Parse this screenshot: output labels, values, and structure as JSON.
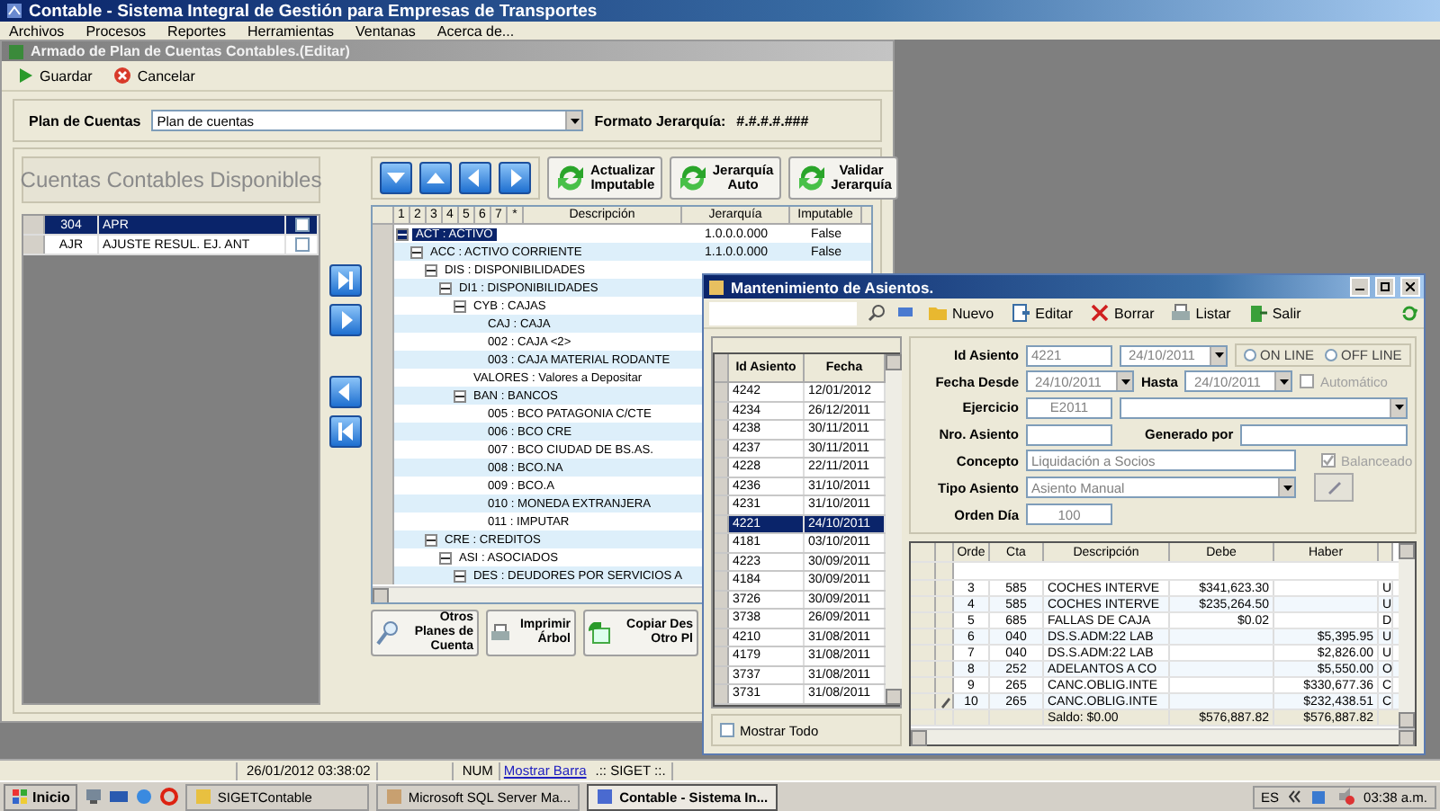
{
  "app": {
    "title": "Contable - Sistema Integral de Gestión para Empresas de Transportes",
    "menu": [
      "Archivos",
      "Procesos",
      "Reportes",
      "Herramientas",
      "Ventanas",
      "Acerca de..."
    ]
  },
  "editor": {
    "title": "Armado de Plan de Cuentas Contables.(Editar)",
    "toolbar": [
      {
        "kind": "save",
        "label": "Guardar"
      },
      {
        "kind": "cancel",
        "label": "Cancelar"
      }
    ],
    "plan_label": "Plan de Cuentas",
    "plan_value": "Plan de cuentas",
    "format_label": "Formato Jerarquía:",
    "format_value": "#.#.#.#.###",
    "available_title": "Cuentas Contables Disponibles",
    "available": [
      {
        "code": "304",
        "name": "APR",
        "checked": false,
        "selected": true
      },
      {
        "code": "AJR",
        "name": "AJUSTE RESUL. EJ. ANT",
        "checked": false,
        "selected": false
      }
    ],
    "actions": [
      "Actualizar Imputable",
      "Jerarquía Auto",
      "Validar Jerarquía"
    ],
    "tree_levels": [
      "1",
      "2",
      "3",
      "4",
      "5",
      "6",
      "7",
      "*"
    ],
    "tree_columns": [
      "Descripción",
      "Jerarquía",
      "Imputable"
    ],
    "tree": [
      {
        "label": "ACT : ACTIVO",
        "jerarquia": "1.0.0.0.000",
        "imputable": "False",
        "selected": true,
        "expanded": true,
        "children": [
          {
            "label": "ACC : ACTIVO CORRIENTE",
            "jerarquia": "1.1.0.0.000",
            "imputable": "False",
            "selected": false,
            "expanded": true,
            "children": [
              {
                "label": "DIS : DISPONIBILIDADES",
                "selected": false,
                "expanded": true,
                "children": [
                  {
                    "label": "DI1 : DISPONIBILIDADES",
                    "selected": false,
                    "expanded": true,
                    "children": [
                      {
                        "label": "CYB : CAJAS",
                        "selected": false,
                        "expanded": true,
                        "children": [
                          {
                            "label": "CAJ : CAJA",
                            "selected": false
                          },
                          {
                            "label": "002 : CAJA <2>",
                            "selected": false
                          },
                          {
                            "label": "003 : CAJA MATERIAL RODANTE",
                            "selected": false
                          }
                        ]
                      },
                      {
                        "label": "VALORES : Valores a Depositar",
                        "selected": false
                      },
                      {
                        "label": "BAN : BANCOS",
                        "selected": false,
                        "expanded": true,
                        "children": [
                          {
                            "label": "005 : BCO PATAGONIA C/CTE",
                            "selected": false
                          },
                          {
                            "label": "006 : BCO CRE",
                            "selected": false
                          },
                          {
                            "label": "007 : BCO CIUDAD DE BS.AS.",
                            "selected": false
                          },
                          {
                            "label": "008 : BCO.NA",
                            "selected": false
                          },
                          {
                            "label": "009 : BCO.A",
                            "selected": false
                          },
                          {
                            "label": "010 : MONEDA EXTRANJERA",
                            "selected": false
                          },
                          {
                            "label": "011 : IMPUTAR",
                            "selected": false
                          }
                        ]
                      }
                    ]
                  }
                ]
              },
              {
                "label": "CRE : CREDITOS",
                "selected": false,
                "expanded": true,
                "children": [
                  {
                    "label": "ASI : ASOCIADOS",
                    "selected": false,
                    "expanded": true,
                    "children": [
                      {
                        "label": "DES : DEUDORES POR SERVICIOS A",
                        "selected": false,
                        "expanded": true
                      }
                    ]
                  }
                ]
              }
            ]
          }
        ]
      }
    ],
    "bottom_buttons": [
      {
        "kind": "search",
        "label": "Otros Planes de Cuenta"
      },
      {
        "kind": "print",
        "label": "Imprimir Árbol"
      },
      {
        "kind": "copy",
        "label": "Copiar Des Otro Pl"
      }
    ]
  },
  "dialog": {
    "title": "Mantenimiento de Asientos.",
    "toolbar": [
      {
        "kind": "new",
        "label": "Nuevo"
      },
      {
        "kind": "edit",
        "label": "Editar"
      },
      {
        "kind": "delete",
        "label": "Borrar"
      },
      {
        "kind": "print",
        "label": "Listar"
      },
      {
        "kind": "exit",
        "label": "Salir"
      }
    ],
    "list_columns": [
      "Id Asiento",
      "Fecha"
    ],
    "list": [
      {
        "id": "4242",
        "fecha": "12/01/2012",
        "selected": false
      },
      {
        "id": "4234",
        "fecha": "26/12/2011",
        "selected": false
      },
      {
        "id": "4238",
        "fecha": "30/11/2011",
        "selected": false
      },
      {
        "id": "4237",
        "fecha": "30/11/2011",
        "selected": false
      },
      {
        "id": "4228",
        "fecha": "22/11/2011",
        "selected": false
      },
      {
        "id": "4236",
        "fecha": "31/10/2011",
        "selected": false
      },
      {
        "id": "4231",
        "fecha": "31/10/2011",
        "selected": false
      },
      {
        "id": "4221",
        "fecha": "24/10/2011",
        "selected": true
      },
      {
        "id": "4181",
        "fecha": "03/10/2011",
        "selected": false
      },
      {
        "id": "4223",
        "fecha": "30/09/2011",
        "selected": false
      },
      {
        "id": "4184",
        "fecha": "30/09/2011",
        "selected": false
      },
      {
        "id": "3726",
        "fecha": "30/09/2011",
        "selected": false
      },
      {
        "id": "3738",
        "fecha": "26/09/2011",
        "selected": false
      },
      {
        "id": "4210",
        "fecha": "31/08/2011",
        "selected": false
      },
      {
        "id": "4179",
        "fecha": "31/08/2011",
        "selected": false
      },
      {
        "id": "3737",
        "fecha": "31/08/2011",
        "selected": false
      },
      {
        "id": "3731",
        "fecha": "31/08/2011",
        "selected": false
      }
    ],
    "show_all": {
      "label": "Mostrar Todo",
      "checked": false
    },
    "form": {
      "id_label": "Id Asiento",
      "id_value": "4221",
      "id_date": "24/10/2011",
      "modes": [
        {
          "label": "ON LINE",
          "selected": false
        },
        {
          "label": "OFF LINE",
          "selected": false
        }
      ],
      "from_label": "Fecha Desde",
      "from_value": "24/10/2011",
      "to_label": "Hasta",
      "to_value": "24/10/2011",
      "auto": {
        "label": "Automático",
        "checked": false,
        "disabled": true
      },
      "year_label": "Ejercicio",
      "year_value": "E2011",
      "number_label": "Nro. Asiento",
      "generated_label": "Generado por",
      "concept_label": "Concepto",
      "concept_value": "Liquidación a Socios",
      "balanced": {
        "label": "Balanceado",
        "checked": true,
        "disabled": true
      },
      "type_label": "Tipo Asiento",
      "type_value": "Asiento Manual",
      "order_label": "Orden Día",
      "order_value": "100"
    },
    "grid_columns": [
      "Orde",
      "Cta",
      "Descripción",
      "Debe",
      "Haber"
    ],
    "grid": [
      {
        "orden": "3",
        "cta": "585",
        "descripcion": "COCHES INTERVE",
        "debe": "$341,623.30",
        "column_6": "U",
        "editing": false
      },
      {
        "orden": "4",
        "cta": "585",
        "descripcion": "COCHES INTERVE",
        "debe": "$235,264.50",
        "column_6": "U",
        "editing": false
      },
      {
        "orden": "5",
        "cta": "685",
        "descripcion": "FALLAS DE CAJA",
        "debe": "$0.02",
        "column_6": "D",
        "editing": false
      },
      {
        "orden": "6",
        "cta": "040",
        "descripcion": "DS.S.ADM:22 LAB",
        "haber": "$5,395.95",
        "column_6": "U",
        "editing": false
      },
      {
        "orden": "7",
        "cta": "040",
        "descripcion": "DS.S.ADM:22 LAB",
        "haber": "$2,826.00",
        "column_6": "U",
        "editing": false
      },
      {
        "orden": "8",
        "cta": "252",
        "descripcion": "ADELANTOS A CO",
        "haber": "$5,550.00",
        "column_6": "O",
        "editing": false
      },
      {
        "orden": "9",
        "cta": "265",
        "descripcion": "CANC.OBLIG.INTE",
        "haber": "$330,677.36",
        "column_6": "C",
        "editing": false
      },
      {
        "orden": "10",
        "cta": "265",
        "descripcion": "CANC.OBLIG.INTE",
        "haber": "$232,438.51",
        "column_6": "C",
        "editing": true
      }
    ],
    "totals": {
      "saldo": "Saldo: $0.00",
      "debe": "$576,887.82",
      "haber": "$576,887.82"
    }
  },
  "status": {
    "datetime": "26/01/2012 03:38:02",
    "num": "NUM",
    "link": "Mostrar Barra",
    "app": ".:: SIGET ::."
  },
  "taskbar": {
    "start": "Inicio",
    "tasks": [
      {
        "label": "SIGETContable",
        "selected": false
      },
      {
        "label": "Microsoft SQL Server Ma...",
        "selected": false
      },
      {
        "label": "Contable - Sistema In...",
        "selected": true
      }
    ],
    "lang": "ES",
    "time": "03:38 a.m."
  }
}
